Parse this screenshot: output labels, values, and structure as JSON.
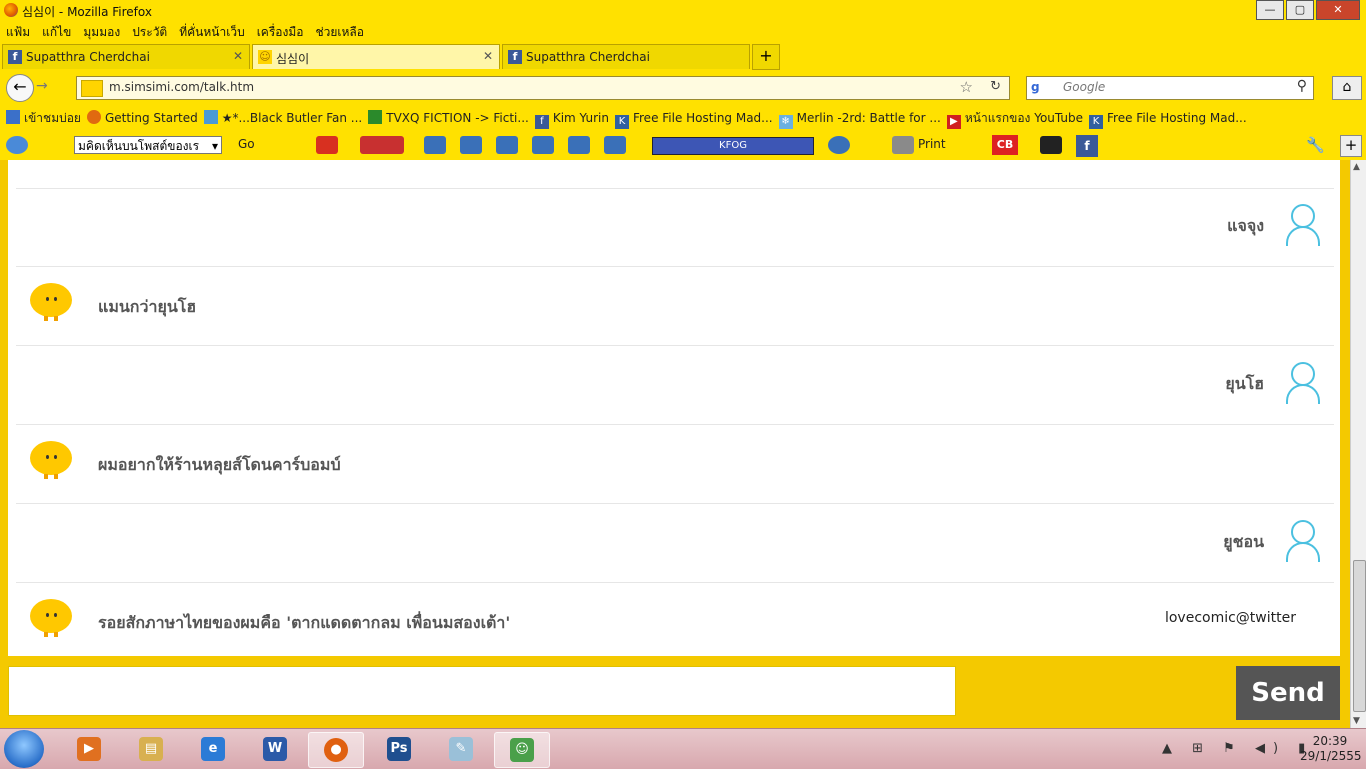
{
  "window": {
    "title": "심심이 - Mozilla Firefox",
    "controls": [
      "—",
      "▢",
      "✕"
    ]
  },
  "menu": [
    "แฟ้ม",
    "แก้ไข",
    "มุมมอง",
    "ประวัติ",
    "ที่คั่นหน้าเว็บ",
    "เครื่องมือ",
    "ช่วยเหลือ"
  ],
  "tabs": [
    {
      "label": "Supatthra Cherdchai",
      "fav": "f",
      "close": "✕"
    },
    {
      "label": "심심이",
      "fav": "☺",
      "close": "✕"
    },
    {
      "label": "Supatthra Cherdchai",
      "fav": "f",
      "close": ""
    }
  ],
  "newtab": "+",
  "nav": {
    "back": "←",
    "forward": "→",
    "url": "m.simsimi.com/talk.htm",
    "star": "☆",
    "reload": "↻",
    "search_placeholder": "Google",
    "search_engine": "g",
    "home": "⌂"
  },
  "bookmarks": [
    {
      "label": "เข้าชมบ่อย",
      "color": "#3b70c9"
    },
    {
      "label": "Getting Started",
      "color": "#e06a10"
    },
    {
      "label": "★*...Black Butler Fan ...",
      "color": "#4a9ad6"
    },
    {
      "label": "TVXQ FICTION -> Ficti...",
      "color": "#2b8a2b"
    },
    {
      "label": "Kim Yurin",
      "color": "#3b5998"
    },
    {
      "label": "Free File Hosting Mad...",
      "color": "#3060a0"
    },
    {
      "label": "Merlin -2rd: Battle for ...",
      "color": "#6ab0e0"
    },
    {
      "label": "หน้าแรกของ YouTube",
      "color": "#d02020"
    },
    {
      "label": "Free File Hosting Mad...",
      "color": "#3060a0"
    }
  ],
  "toolbar2": {
    "select_value": "มคิดเห็นบนโพสต์ของเร",
    "go": "Go",
    "player_label": "KFOG",
    "print": "Print",
    "cb": "CB",
    "fb": "f",
    "wrench": "🔧",
    "plus": "+"
  },
  "chat": [
    {
      "from": "user",
      "text": "แจจุง"
    },
    {
      "from": "sim",
      "text": "แมนกว่ายุนโฮ"
    },
    {
      "from": "user",
      "text": "ยุนโฮ"
    },
    {
      "from": "sim",
      "text": "ผมอยากให้ร้านหลุยส์โดนคาร์บอมบ์"
    },
    {
      "from": "user",
      "text": "ยูชอน"
    },
    {
      "from": "sim",
      "text": "รอยสักภาษาไทยของผมคือ  'ตากแดดตากลม เพื่อนมสองเต้า'"
    }
  ],
  "credit": "lovecomic@twitter",
  "input": {
    "value": "",
    "send": "Send"
  },
  "scroll": {
    "up": "▲",
    "down": "▼"
  },
  "taskbar": {
    "apps": [
      {
        "name": "media-player",
        "color": "#e07020",
        "glyph": "▶"
      },
      {
        "name": "explorer",
        "color": "#d8b050",
        "glyph": "▤"
      },
      {
        "name": "internet-explorer",
        "color": "#2b7bd6",
        "glyph": "e"
      },
      {
        "name": "word",
        "color": "#2b5aa8",
        "glyph": "W"
      },
      {
        "name": "firefox",
        "color": "#e06010",
        "glyph": "●"
      },
      {
        "name": "photoshop",
        "color": "#1f4f8f",
        "glyph": "Ps"
      },
      {
        "name": "notes",
        "color": "#9ac0d8",
        "glyph": "✎"
      },
      {
        "name": "messenger",
        "color": "#4aa04a",
        "glyph": "☺"
      }
    ],
    "tray": "▲ ⊞ ⚑ ◀) ▮",
    "time": "20:39",
    "date": "29/1/2555"
  }
}
